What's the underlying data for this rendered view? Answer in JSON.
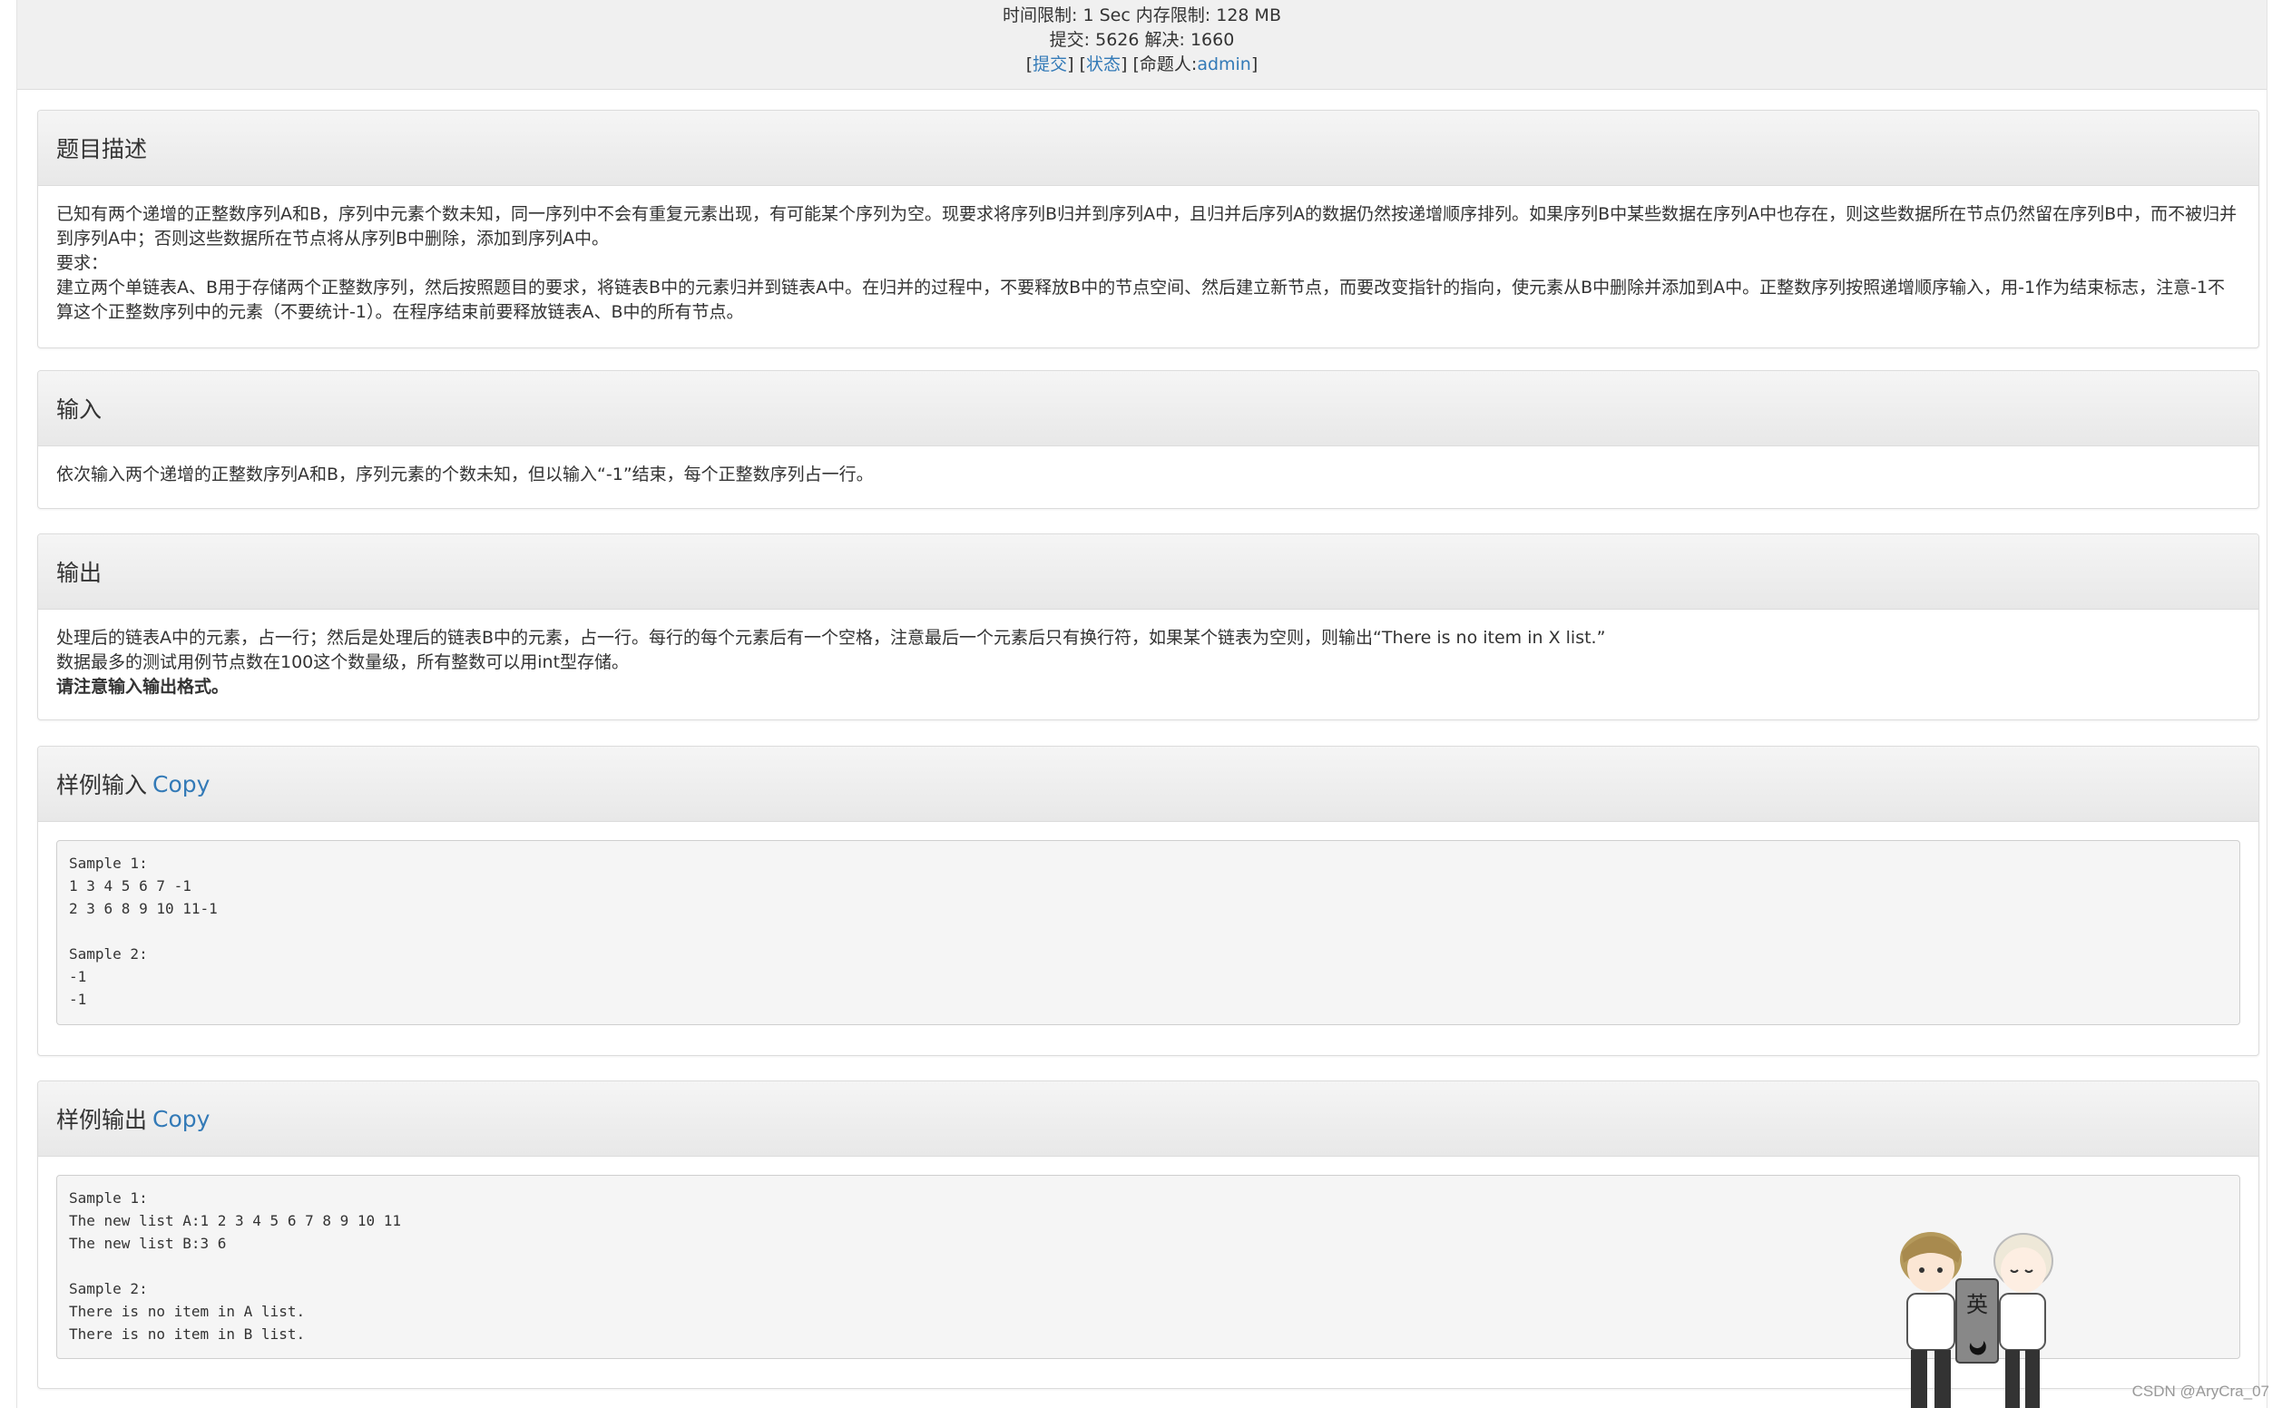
{
  "header": {
    "line1": "时间限制: 1 Sec  内存限制: 128 MB",
    "line2": "提交: 5626  解决: 1660",
    "submit_link": "提交",
    "status_link": "状态",
    "setter_label": "[命题人:",
    "setter_name": "admin",
    "setter_close": "]"
  },
  "description": {
    "title": "题目描述",
    "lines": [
      "已知有两个递增的正整数序列A和B，序列中元素个数未知，同一序列中不会有重复元素出现，有可能某个序列为空。现要求将序列B归并到序列A中，且归并后序列A的数据仍然按递增顺序排列。如果序列B中某些数据在序列A中也存在，则这些数据所在节点仍然留在序列B中，而不被归并到序列A中；否则这些数据所在节点将从序列B中删除，添加到序列A中。",
      "要求：",
      "建立两个单链表A、B用于存储两个正整数序列，然后按照题目的要求，将链表B中的元素归并到链表A中。在归并的过程中，不要释放B中的节点空间、然后建立新节点，而要改变指针的指向，使元素从B中删除并添加到A中。正整数序列按照递增顺序输入，用-1作为结束标志，注意-1不算这个正整数序列中的元素（不要统计-1）。在程序结束前要释放链表A、B中的所有节点。"
    ]
  },
  "input": {
    "title": "输入",
    "text": "依次输入两个递增的正整数序列A和B，序列元素的个数未知，但以输入“-1”结束，每个正整数序列占一行。"
  },
  "output": {
    "title": "输出",
    "line1": "处理后的链表A中的元素，占一行；然后是处理后的链表B中的元素，占一行。每行的每个元素后有一个空格，注意最后一个元素后只有换行符，如果某个链表为空则，则输出“There is no item in X list.”",
    "line2": "数据最多的测试用例节点数在100这个数量级，所有整数可以用int型存储。",
    "line3": "请注意输入输出格式。"
  },
  "sample_input": {
    "title": "样例输入",
    "copy": "Copy",
    "text": "Sample 1:\n1 3 4 5 6 7 -1\n2 3 6 8 9 10 11-1\n\nSample 2:\n-1\n-1"
  },
  "sample_output": {
    "title": "样例输出",
    "copy": "Copy",
    "text": "Sample 1:\nThe new list A:1 2 3 4 5 6 7 8 9 10 11\nThe new list B:3 6\n\nSample 2:\nThere is no item in A list.\nThere is no item in B list."
  },
  "mascot": {
    "sign_char": "英"
  },
  "watermark": "CSDN @AryCra_07",
  "colors": {
    "link": "#337ab7",
    "panel_heading": "#eeeeee",
    "code_bg": "#f5f5f5"
  }
}
